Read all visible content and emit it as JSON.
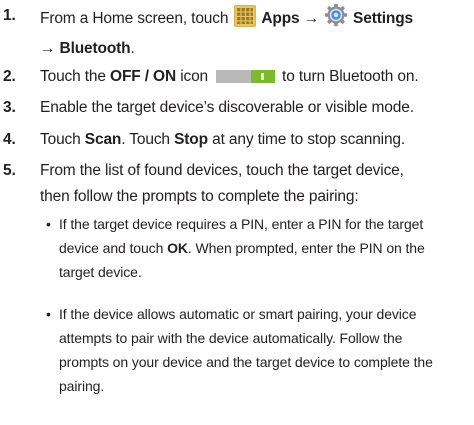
{
  "steps": [
    {
      "num": "1.",
      "lead": "From a Home screen, touch",
      "apps": "Apps",
      "arrow1": "→",
      "settings": "Settings",
      "arrow2": "→",
      "bluetooth": "Bluetooth",
      "end": ".",
      "apps_icon": "apps-grid-icon",
      "settings_icon": "settings-gear-icon"
    },
    {
      "num": "2.",
      "pre": "Touch the",
      "bold": "OFF / ON",
      "mid": "icon",
      "post": "to turn Bluetooth on.",
      "toggle_icon": "on-off-toggle-icon",
      "toggle_color": "#7cba2c"
    },
    {
      "num": "3.",
      "text": "Enable the target device’s discoverable or visible mode."
    },
    {
      "num": "4.",
      "pre": "Touch",
      "scan": "Scan",
      "mid": ". Touch",
      "stop": "Stop",
      "post": "at any time to stop scanning."
    },
    {
      "num": "5.",
      "line1": "From the list of found devices, touch the target device,",
      "line2": "then follow the prompts to complete the pairing:",
      "bullets": [
        {
          "symbol": "•",
          "line1": "If the target device requires a PIN, enter a PIN for the target",
          "line2_pre": "device and touch",
          "line2_bold": "OK",
          "line2_post": ". When prompted, enter the PIN on the",
          "line3": "target device."
        },
        {
          "symbol": "•",
          "line1": "If the device allows automatic or smart pairing, your device",
          "line2": "attempts to pair with the device automatically. Follow the",
          "line3": "prompts on your device and the target device to complete the",
          "line4": "pairing."
        }
      ]
    }
  ]
}
